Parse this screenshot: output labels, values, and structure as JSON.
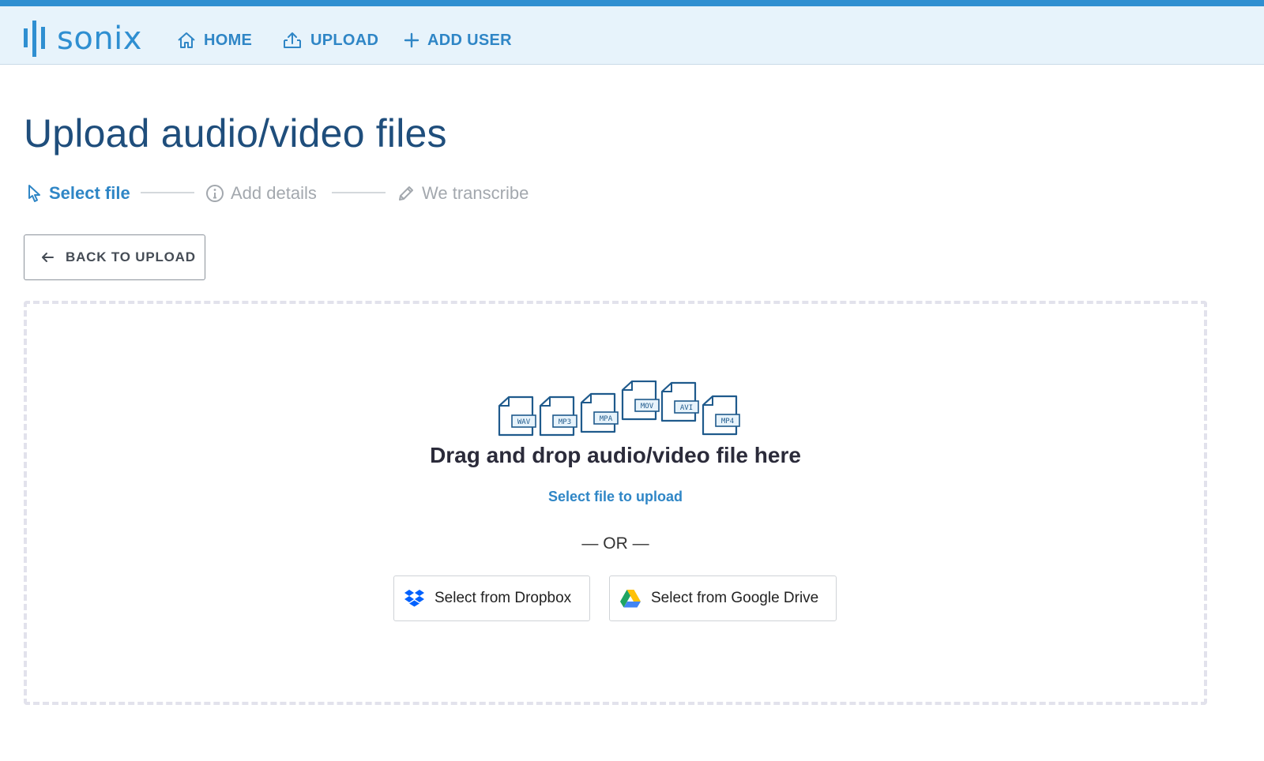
{
  "brand": {
    "name": "sonix",
    "color": "#2f8fd1"
  },
  "nav": {
    "home": "HOME",
    "upload": "UPLOAD",
    "add_user": "ADD USER"
  },
  "page": {
    "title": "Upload audio/video files"
  },
  "steps": [
    {
      "label": "Select file",
      "icon": "cursor-icon",
      "active": true
    },
    {
      "label": "Add details",
      "icon": "info-icon",
      "active": false
    },
    {
      "label": "We transcribe",
      "icon": "pencil-icon",
      "active": false
    }
  ],
  "back_button": {
    "label": "BACK TO UPLOAD"
  },
  "dropzone": {
    "file_types": [
      "WAV",
      "MP3",
      "MPA",
      "MOV",
      "AVI",
      "MP4"
    ],
    "drag_text": "Drag and drop audio/video file here",
    "select_link": "Select file to upload",
    "or_text": "— OR —",
    "dropbox_label": "Select from Dropbox",
    "gdrive_label": "Select from Google Drive"
  },
  "colors": {
    "accent": "#2f86c6",
    "nav_bg": "#e7f3fb",
    "title": "#1f4e7c",
    "muted": "#a3a8ae"
  }
}
